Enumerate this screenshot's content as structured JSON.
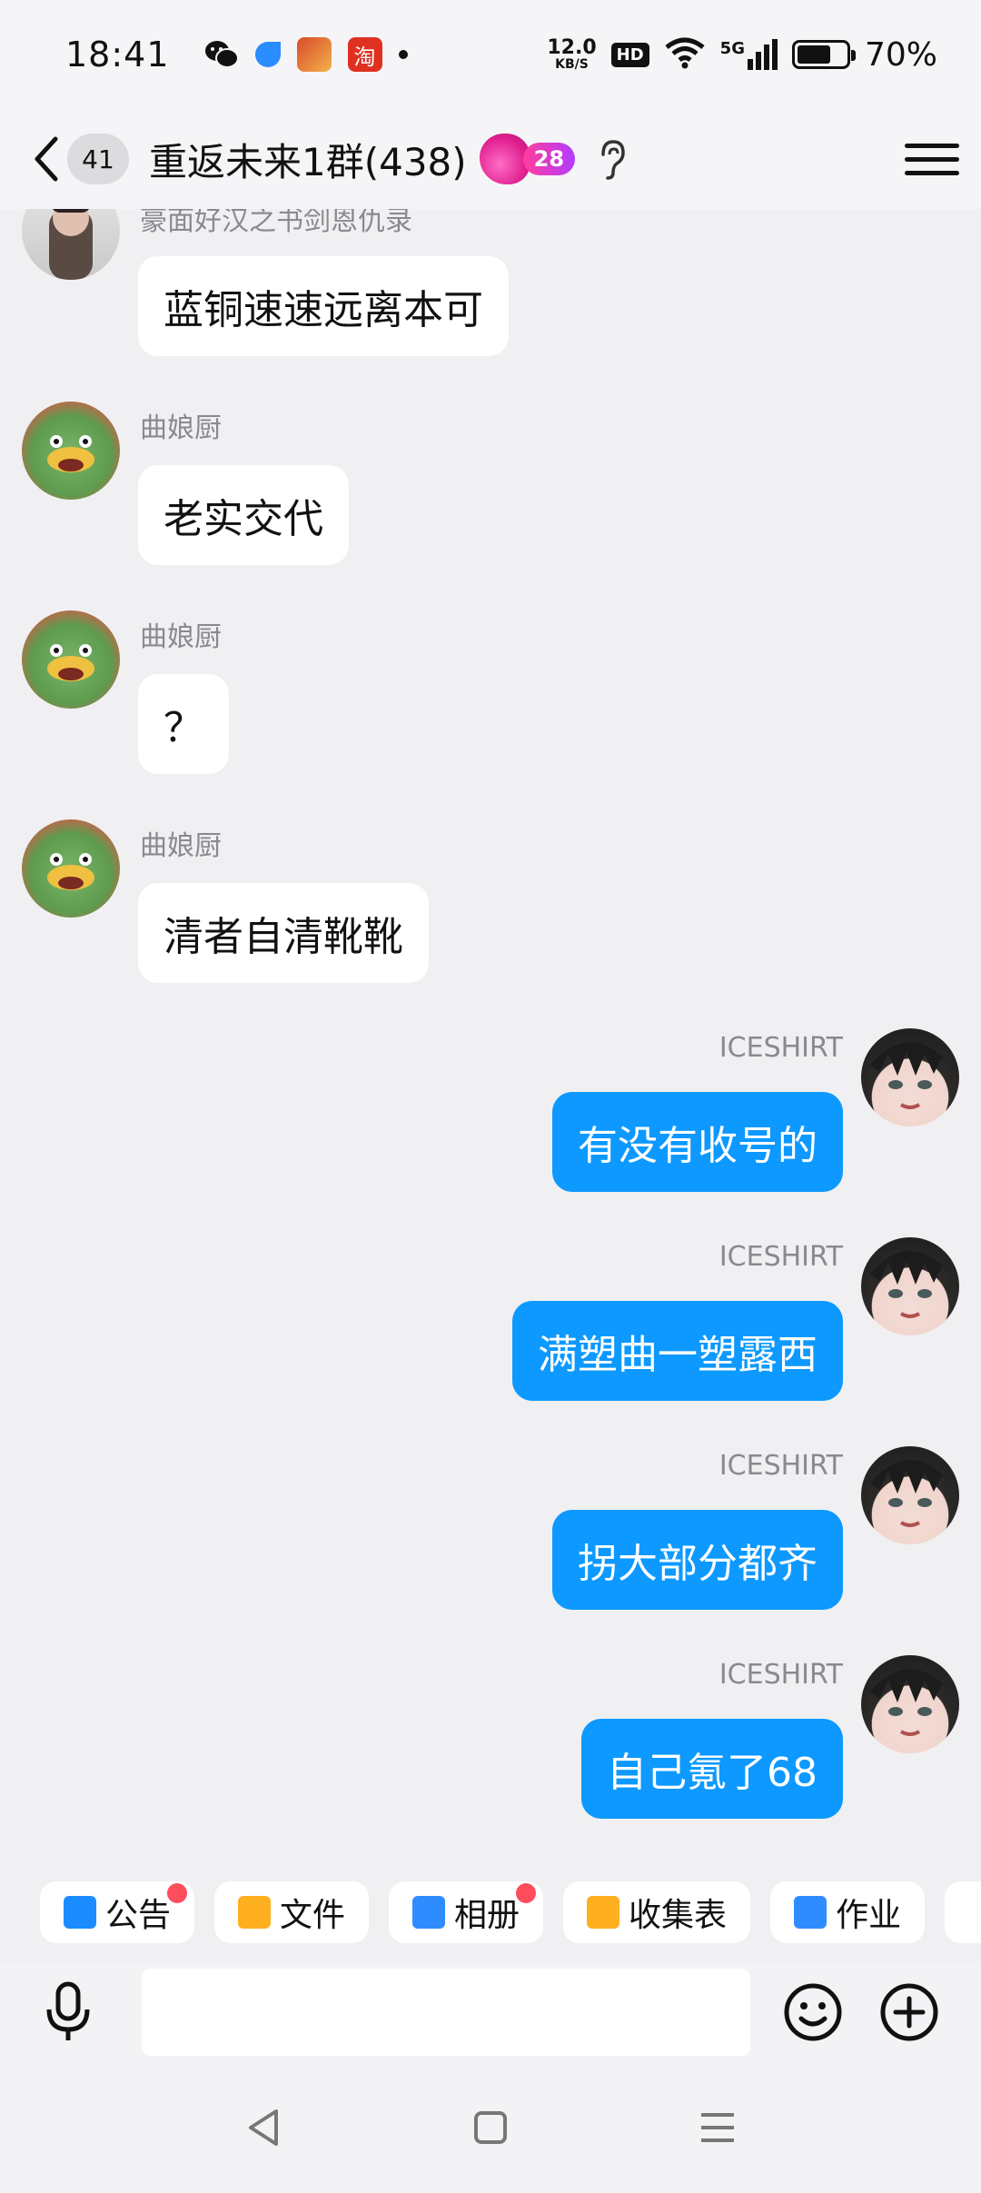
{
  "status_bar": {
    "time": "18:41",
    "net_speed_value": "12.0",
    "net_speed_unit": "KB/S",
    "hd": "HD",
    "signal": "5G",
    "battery_pct": "70%",
    "battery_level": 0.7,
    "taobao_icon_text": "淘"
  },
  "header": {
    "unread_count": "41",
    "title": "重返未来1群(438)",
    "fire_count": "28"
  },
  "messages": [
    {
      "side": "in",
      "nick": "豪面好汉之书剑恩仇录",
      "text": "蓝铜速速远离本可"
    },
    {
      "side": "in",
      "nick": "曲娘厨",
      "text": "老实交代"
    },
    {
      "side": "in",
      "nick": "曲娘厨",
      "text": "？"
    },
    {
      "side": "in",
      "nick": "曲娘厨",
      "text": "清者自清靴靴"
    },
    {
      "side": "out",
      "nick": "ICESHIRT",
      "text": "有没有收号的"
    },
    {
      "side": "out",
      "nick": "ICESHIRT",
      "text": "满塑曲一塑露西"
    },
    {
      "side": "out",
      "nick": "ICESHIRT",
      "text": "拐大部分都齐"
    },
    {
      "side": "out",
      "nick": "ICESHIRT",
      "text": "自己氪了68"
    }
  ],
  "toolbar": {
    "items": [
      {
        "label": "公告",
        "color": "#1a8cff"
      },
      {
        "label": "文件",
        "color": "#ffb020"
      },
      {
        "label": "相册",
        "color": "#2f8cff"
      },
      {
        "label": "收集表",
        "color": "#ffb020"
      },
      {
        "label": "作业",
        "color": "#2f8cff"
      }
    ]
  },
  "input": {
    "value": "",
    "placeholder": ""
  },
  "colors": {
    "accent": "#0d99ff",
    "badge_red": "#ff4d5e"
  }
}
